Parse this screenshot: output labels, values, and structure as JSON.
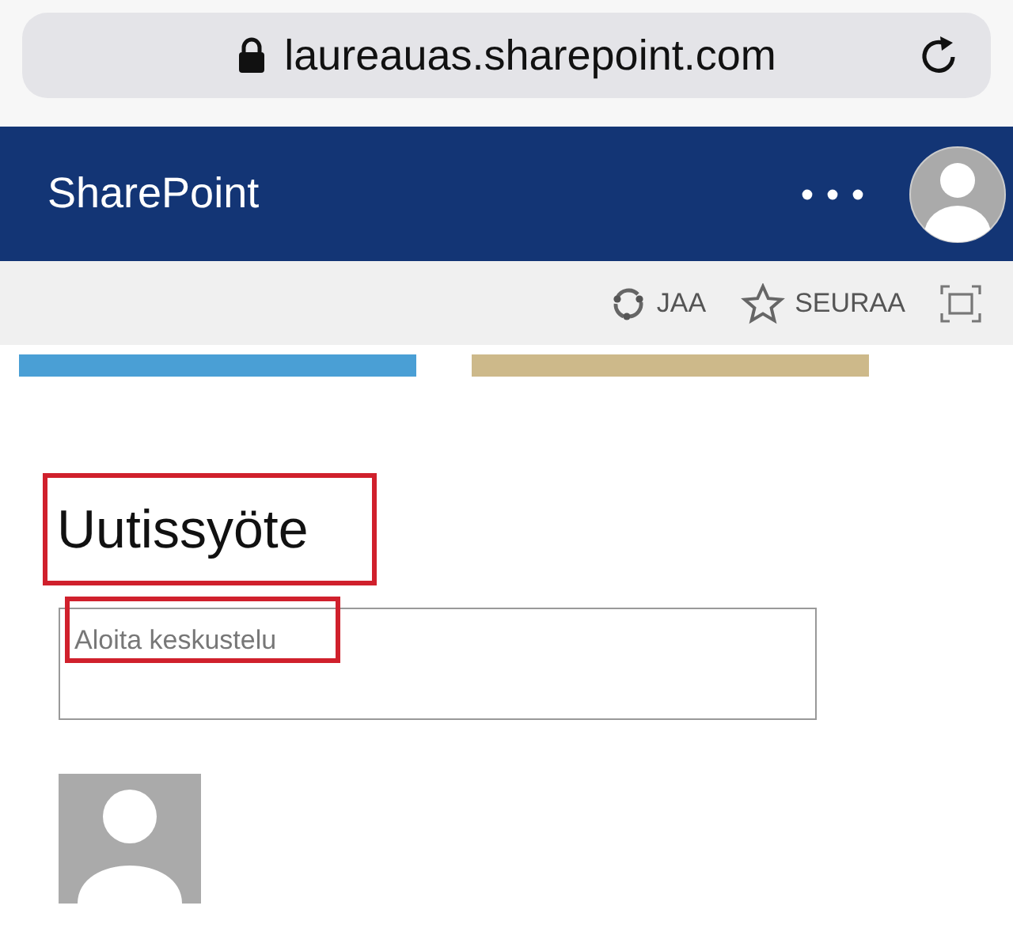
{
  "browser": {
    "url": "laureauas.sharepoint.com"
  },
  "header": {
    "title": "SharePoint"
  },
  "toolbar": {
    "actions": [
      {
        "kind": "share",
        "label": "JAA"
      },
      {
        "kind": "follow",
        "label": "SEURAA"
      }
    ]
  },
  "tiles": [
    {
      "color": "#4a9fd5"
    },
    {
      "color": "#cdb98a"
    }
  ],
  "feed": {
    "title": "Uutissyöte",
    "title_highlighted": true,
    "placeholder": "Aloita keskustelu",
    "placeholder_highlighted": true
  }
}
